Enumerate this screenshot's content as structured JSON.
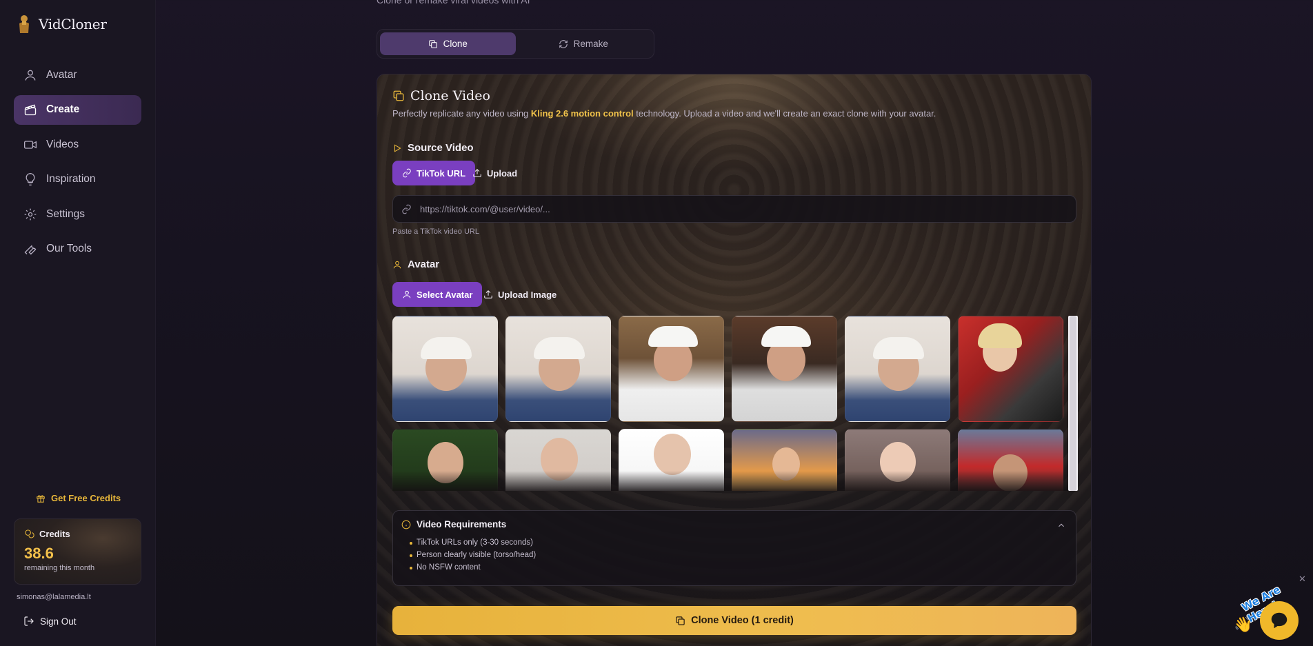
{
  "app": {
    "name": "VidCloner",
    "subtitle": "Clone or remake viral videos with AI"
  },
  "sidebar": {
    "items": [
      {
        "label": "Avatar",
        "icon": "user-icon"
      },
      {
        "label": "Create",
        "icon": "clapperboard-icon",
        "active": true
      },
      {
        "label": "Videos",
        "icon": "video-camera-icon"
      },
      {
        "label": "Inspiration",
        "icon": "lightbulb-icon"
      },
      {
        "label": "Settings",
        "icon": "gear-icon"
      },
      {
        "label": "Our Tools",
        "icon": "wrench-icon"
      }
    ],
    "free_credits": "Get Free Credits",
    "credits": {
      "title": "Credits",
      "amount": "38.6",
      "sub": "remaining this month"
    },
    "email": "simonas@lalamedia.lt",
    "signout": "Sign Out"
  },
  "tabs": [
    {
      "label": "Clone",
      "active": true,
      "icon": "copy-icon"
    },
    {
      "label": "Remake",
      "active": false,
      "icon": "refresh-icon"
    }
  ],
  "card": {
    "title": "Clone Video",
    "desc_pre": "Perfectly replicate any video using ",
    "desc_highlight": "Kling 2.6 motion control",
    "desc_post": " technology. Upload a video and we'll create an exact clone with your avatar.",
    "source": {
      "heading": "Source Video",
      "tiktok_btn": "TikTok URL",
      "upload_btn": "Upload",
      "placeholder": "https://tiktok.com/@user/video/...",
      "value": "",
      "hint": "Paste a TikTok video URL"
    },
    "avatar": {
      "heading": "Avatar",
      "select_btn": "Select Avatar",
      "upload_btn": "Upload Image"
    },
    "requirements": {
      "heading": "Video Requirements",
      "items": [
        "TikTok URLs only (3-30 seconds)",
        "Person clearly visible (torso/head)",
        "No NSFW content"
      ]
    },
    "cta": "Clone Video (1 credit)"
  },
  "chat": {
    "label": "We Are Here!",
    "icon": "chat-bubble-icon"
  },
  "colors": {
    "accent": "#e8b73a",
    "purple": "#7a3fc0",
    "bg": "#171320"
  }
}
